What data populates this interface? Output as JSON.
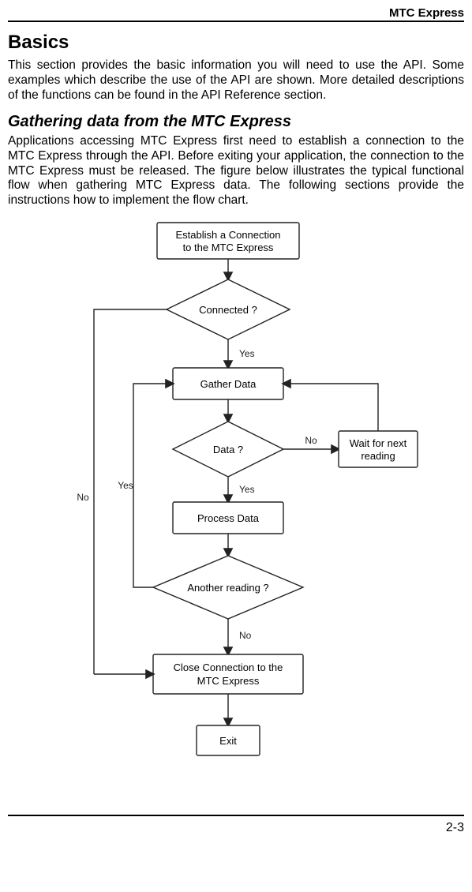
{
  "header": {
    "doc_title": "MTC Express"
  },
  "section": {
    "heading": "Basics",
    "intro": "This section provides the basic information you will need to use the API. Some examples which describe the use of the API are shown.  More detailed descriptions of the functions can be found in the API Reference section.",
    "subheading": "Gathering data from the MTC Express",
    "subintro": "Applications accessing MTC Express first need to establish a connection to the MTC Express through the API. Before exiting your application, the connection to the MTC Express must be released.  The figure below illustrates the typical functional flow when gathering MTC Express data. The following sections provide the instructions how to implement the flow chart."
  },
  "flowchart": {
    "establish_l1": "Establish a Connection",
    "establish_l2": "to the MTC Express",
    "connected": "Connected ?",
    "gather": "Gather Data",
    "data": "Data ?",
    "wait_l1": "Wait for next",
    "wait_l2": "reading",
    "process": "Process Data",
    "another": "Another reading ?",
    "close_l1": "Close Connection to the",
    "close_l2": "MTC Express",
    "exit": "Exit",
    "yes": "Yes",
    "no": "No"
  },
  "footer": {
    "page_num": "2-3"
  }
}
